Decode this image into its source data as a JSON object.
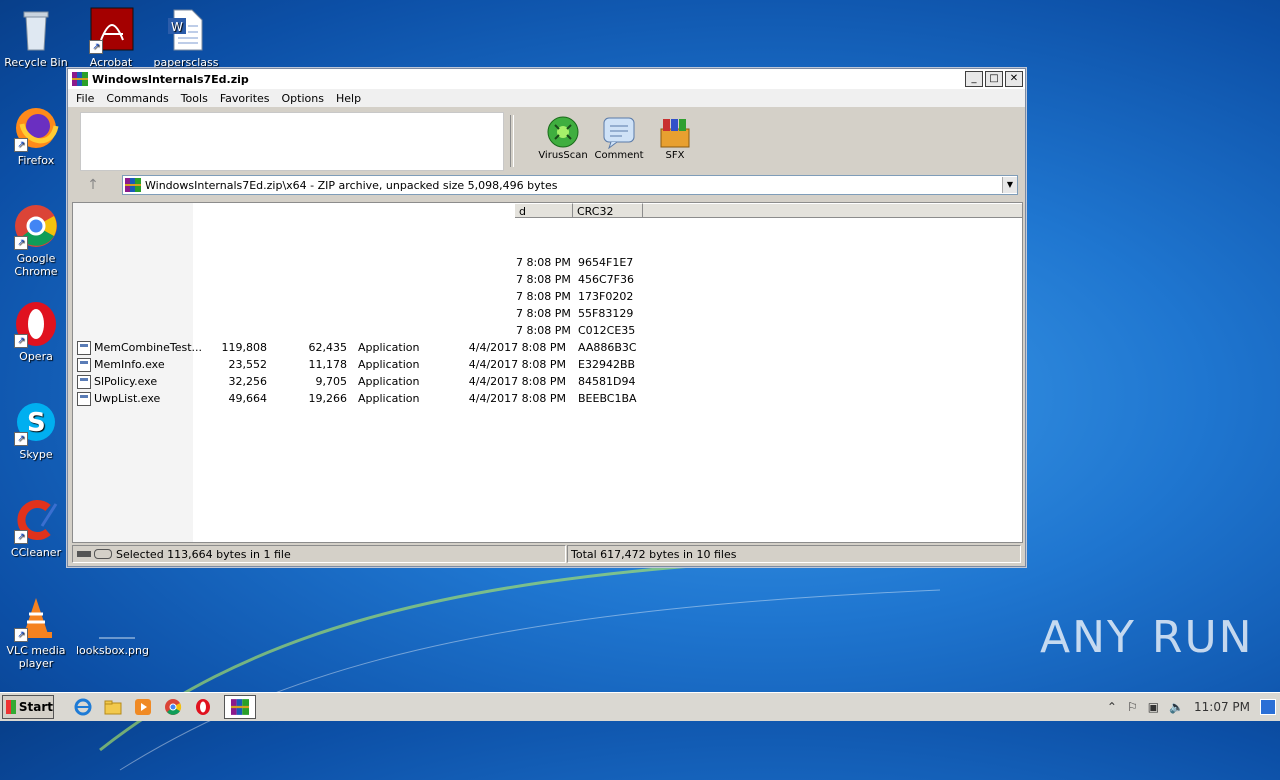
{
  "desktop": {
    "icons": [
      {
        "label": "Recycle Bin"
      },
      {
        "label": "Acrobat"
      },
      {
        "label": "papersclass"
      },
      {
        "label": "Firefox"
      },
      {
        "label": "Google Chrome"
      },
      {
        "label": "Opera"
      },
      {
        "label": "Skype"
      },
      {
        "label": "CCleaner"
      },
      {
        "label": "VLC media player"
      },
      {
        "label": "looksbox.png"
      }
    ],
    "watermark": "ANY RUN"
  },
  "window": {
    "title": "WindowsInternals7Ed.zip",
    "menu": [
      "File",
      "Commands",
      "Tools",
      "Favorites",
      "Options",
      "Help"
    ],
    "toolbar": [
      {
        "label": "VirusScan",
        "icon": "virusscan-icon"
      },
      {
        "label": "Comment",
        "icon": "comment-icon"
      },
      {
        "label": "SFX",
        "icon": "sfx-icon"
      }
    ],
    "address": "WindowsInternals7Ed.zip\\x64 - ZIP archive, unpacked size 5,098,496 bytes",
    "columns": {
      "modified_partial": "d",
      "crc": "CRC32"
    },
    "partial_rows": [
      {
        "modified": "7 8:08 PM",
        "crc": "9654F1E7"
      },
      {
        "modified": "7 8:08 PM",
        "crc": "456C7F36"
      },
      {
        "modified": "7 8:08 PM",
        "crc": "173F0202"
      },
      {
        "modified": "7 8:08 PM",
        "crc": "55F83129"
      },
      {
        "modified": "7 8:08 PM",
        "crc": "C012CE35"
      }
    ],
    "rows": [
      {
        "name": "MemCombineTest...",
        "size": "119,808",
        "packed": "62,435",
        "type": "Application",
        "modified": "4/4/2017 8:08 PM",
        "crc": "AA886B3C"
      },
      {
        "name": "MemInfo.exe",
        "size": "23,552",
        "packed": "11,178",
        "type": "Application",
        "modified": "4/4/2017 8:08 PM",
        "crc": "E32942BB"
      },
      {
        "name": "SlPolicy.exe",
        "size": "32,256",
        "packed": "9,705",
        "type": "Application",
        "modified": "4/4/2017 8:08 PM",
        "crc": "84581D94"
      },
      {
        "name": "UwpList.exe",
        "size": "49,664",
        "packed": "19,266",
        "type": "Application",
        "modified": "4/4/2017 8:08 PM",
        "crc": "BEEBC1BA"
      }
    ],
    "status": {
      "selected": "Selected 113,664 bytes in 1 file",
      "total": "Total 617,472 bytes in 10 files"
    }
  },
  "taskbar": {
    "start": "Start",
    "clock": "11:07 PM"
  }
}
